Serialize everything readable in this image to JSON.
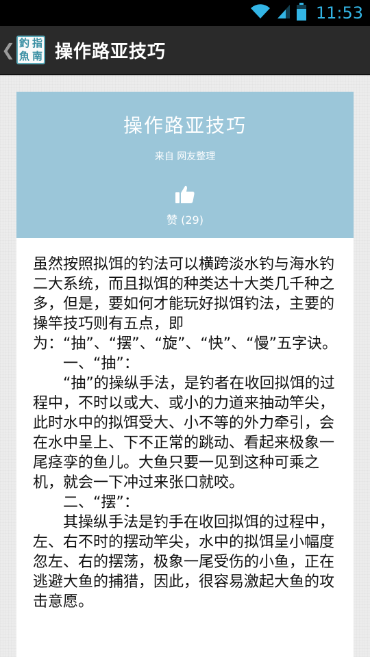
{
  "status_bar": {
    "time": "11:53",
    "icons": [
      "wifi-icon",
      "signal-icon",
      "battery-icon"
    ]
  },
  "action_bar": {
    "logo_chars": [
      "釣",
      "指",
      "魚",
      "南"
    ],
    "title": "操作路亚技巧"
  },
  "article": {
    "title": "操作路亚技巧",
    "source": "来自 网友整理",
    "like_label": "赞 (29)",
    "paragraphs": [
      "虽然按照拟饵的钓法可以横跨淡水钓与海水钓二大系统，而且拟饵的种类达十大类几千种之多，但是，要如何才能玩好拟饵钓法，主要的操竿技巧则有五点，即为：“抽”、“摆”、“旋”、“快”、“慢”五字诀。",
      "一、“抽”：",
      "“抽”的操纵手法，是钓者在收回拟饵的过程中，不时以或大、或小的力道来抽动竿尖，此时水中的拟饵受大、小不等的外力牵引，会在水中呈上、下不正常的跳动、看起来极象一尾痉孪的鱼儿。大鱼只要一见到这种可乘之机，就会一下冲过来张口就咬。",
      "二、“摆”：",
      "其操纵手法是钓手在收回拟饵的过程中，左、右不时的摆动竿尖，水中的拟饵呈小幅度忽左、右的摆荡，极象一尾受伤的小鱼，正在逃避大鱼的捕猎，因此，很容易激起大鱼的攻击意愿。"
    ]
  },
  "colors": {
    "status_accent": "#33b5e5",
    "action_bar_bg": "#2a2a2a",
    "header_bg": "#9bc6d9",
    "body_text": "#111111"
  }
}
